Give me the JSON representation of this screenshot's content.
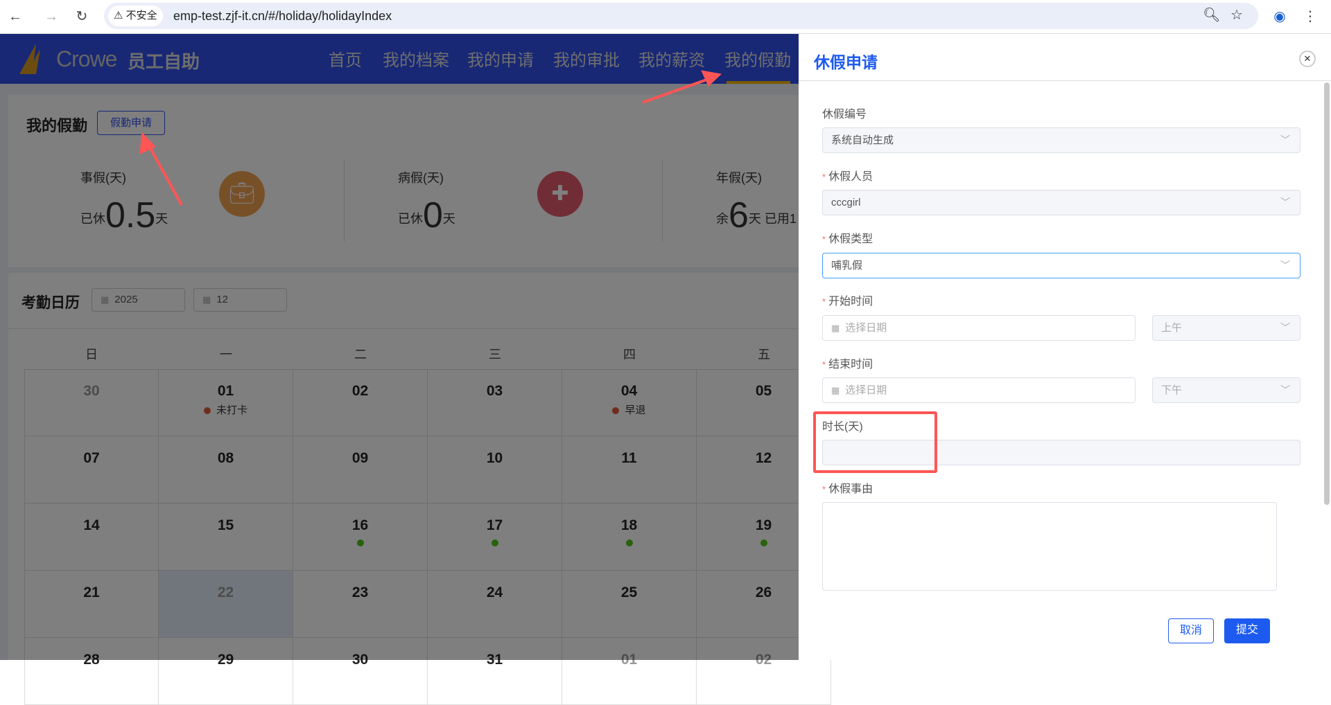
{
  "browser": {
    "back_icon": "arrow-left-icon",
    "forward_icon": "arrow-right-icon",
    "reload_icon": "reload-icon",
    "security_label": "不安全",
    "url": "emp-test.zjf-it.cn/#/holiday/holidayIndex"
  },
  "header": {
    "brand": "Crowe",
    "app_name": "员工自助",
    "nav": [
      "首页",
      "我的档案",
      "我的申请",
      "我的审批",
      "我的薪资",
      "我的假勤"
    ],
    "active_nav": "我的假勤",
    "colors": {
      "header": "#3050ea",
      "active_underline": "#f0b400"
    }
  },
  "summary": {
    "title": "我的假勤",
    "apply_button": "假勤申请",
    "stats": [
      {
        "label": "事假(天)",
        "prefix": "已休",
        "value": "0.5",
        "suffix": "天",
        "icon": "briefcase-clock-icon",
        "color": "#f0a050"
      },
      {
        "label": "病假(天)",
        "prefix": "已休",
        "value": "0",
        "suffix": "天",
        "icon": "medical-cross-icon",
        "color": "#e05a6a"
      },
      {
        "label": "年假(天)",
        "prefix": "余",
        "value": "6",
        "suffix": "天 已用1"
      }
    ]
  },
  "calendar": {
    "title": "考勤日历",
    "year": "2025",
    "month": "12",
    "weekdays": [
      "日",
      "一",
      "二",
      "三",
      "四",
      "五"
    ],
    "rows": [
      [
        {
          "d": "30",
          "muted": true
        },
        {
          "d": "01",
          "tag": "未打卡",
          "dot": "#e05a3a"
        },
        {
          "d": "02"
        },
        {
          "d": "03"
        },
        {
          "d": "04",
          "tag": "早退",
          "dot": "#e05a3a"
        },
        {
          "d": "05"
        }
      ],
      [
        {
          "d": "07"
        },
        {
          "d": "08"
        },
        {
          "d": "09"
        },
        {
          "d": "10"
        },
        {
          "d": "11"
        },
        {
          "d": "12"
        }
      ],
      [
        {
          "d": "14"
        },
        {
          "d": "15"
        },
        {
          "d": "16",
          "dot": "#52c41a"
        },
        {
          "d": "17",
          "dot": "#52c41a"
        },
        {
          "d": "18",
          "dot": "#52c41a"
        },
        {
          "d": "19",
          "dot": "#52c41a"
        }
      ],
      [
        {
          "d": "21"
        },
        {
          "d": "22",
          "today": true,
          "muted": true
        },
        {
          "d": "23"
        },
        {
          "d": "24"
        },
        {
          "d": "25"
        },
        {
          "d": "26"
        }
      ],
      [
        {
          "d": "28"
        },
        {
          "d": "29"
        },
        {
          "d": "30"
        },
        {
          "d": "31"
        },
        {
          "d": "01",
          "muted": true
        },
        {
          "d": "02",
          "muted": true
        }
      ]
    ]
  },
  "drawer": {
    "title": "休假申请",
    "fields": {
      "number": {
        "label": "休假编号",
        "value": "系统自动生成"
      },
      "person": {
        "label": "休假人员",
        "value": "cccgirl"
      },
      "type": {
        "label": "休假类型",
        "value": "哺乳假"
      },
      "start": {
        "label": "开始时间",
        "placeholder": "选择日期",
        "period": "上午"
      },
      "end": {
        "label": "结束时间",
        "placeholder": "选择日期",
        "period": "下午"
      },
      "duration": {
        "label": "时长(天)",
        "value": ""
      },
      "reason": {
        "label": "休假事由",
        "value": ""
      }
    },
    "required_mark": "*",
    "cancel": "取消",
    "submit": "提交"
  }
}
